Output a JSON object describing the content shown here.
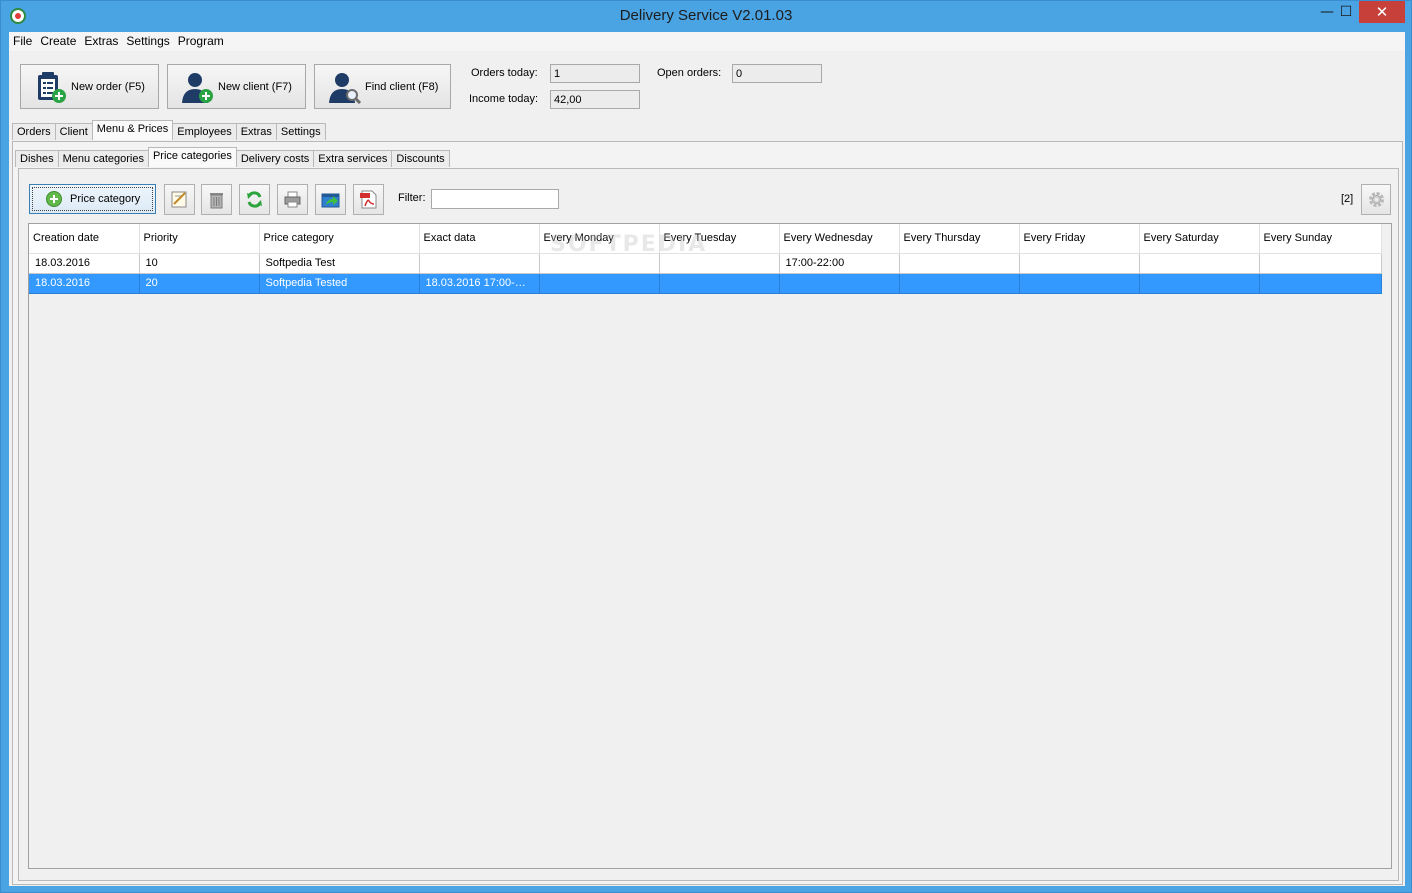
{
  "window": {
    "title": "Delivery Service V2.01.03",
    "minimize_glyph": "—",
    "maximize_glyph": "☐",
    "close_glyph": "✕"
  },
  "menu": [
    "File",
    "Create",
    "Extras",
    "Settings",
    "Program"
  ],
  "toolbar": {
    "new_order": "New order (F5)",
    "new_client": "New client (F7)",
    "find_client": "Find client (F8)"
  },
  "stats": {
    "orders_today_label": "Orders today:",
    "orders_today_value": "1",
    "income_today_label": "Income today:",
    "income_today_value": "42,00",
    "open_orders_label": "Open orders:",
    "open_orders_value": "0"
  },
  "main_tabs": [
    "Orders",
    "Client",
    "Menu & Prices",
    "Employees",
    "Extras",
    "Settings"
  ],
  "main_tab_active": "Menu & Prices",
  "sub_tabs": [
    "Dishes",
    "Menu categories",
    "Price categories",
    "Delivery costs",
    "Extra services",
    "Discounts"
  ],
  "sub_tab_active": "Price categories",
  "actions": {
    "add_label": "Price category",
    "filter_label": "Filter:",
    "filter_value": "",
    "count": "[2]"
  },
  "icons": {
    "add": "plus-circle-icon",
    "edit": "edit-icon",
    "delete": "trash-icon",
    "refresh": "refresh-icon",
    "print": "printer-icon",
    "export": "export-icon",
    "pdf": "pdf-icon",
    "settings": "gear-icon"
  },
  "table": {
    "columns": [
      "Creation date",
      "Priority",
      "Price category",
      "Exact data",
      "Every Monday",
      "Every Tuesday",
      "Every Wednesday",
      "Every Thursday",
      "Every Friday",
      "Every Saturday",
      "Every Sunday"
    ],
    "rows": [
      [
        "18.03.2016",
        "10",
        "Softpedia Test",
        "",
        "",
        "",
        "17:00-22:00",
        "",
        "",
        "",
        ""
      ],
      [
        "18.03.2016",
        "20",
        "Softpedia Tested",
        "18.03.2016 17:00-…",
        "",
        "",
        "",
        "",
        "",
        "",
        ""
      ]
    ],
    "selected_row": 1
  },
  "watermark": "SOFTPEDIA",
  "colors": {
    "title_bar": "#4aa3e3",
    "selection": "#3399ff",
    "close_button": "#c7403a"
  }
}
